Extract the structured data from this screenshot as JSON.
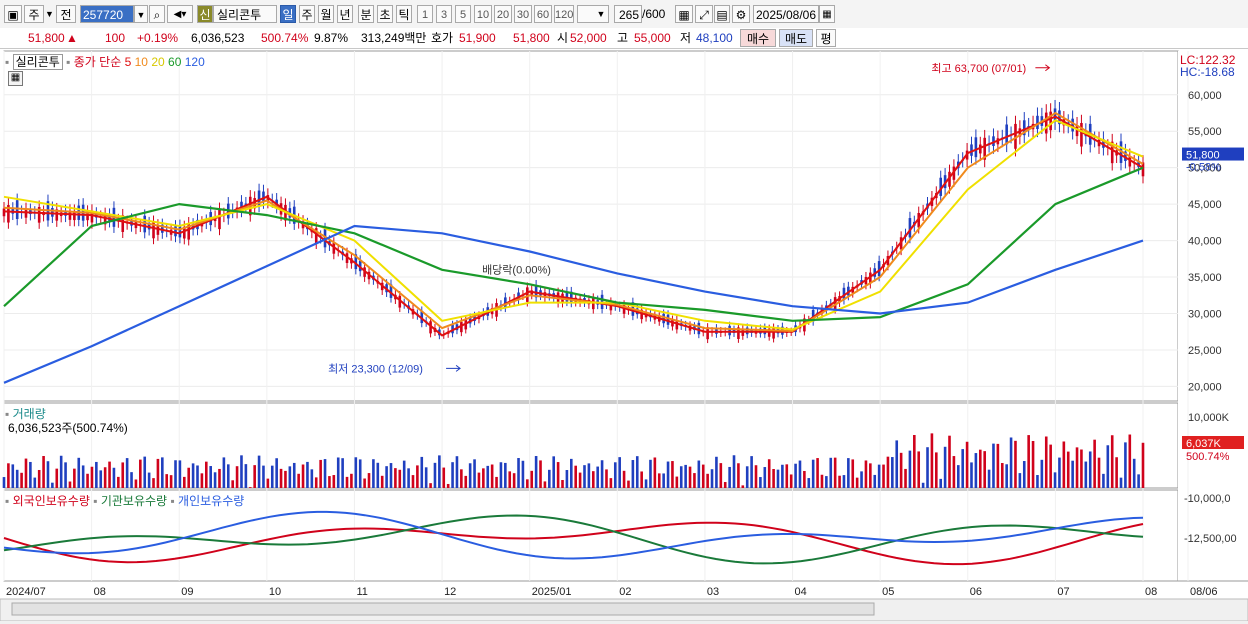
{
  "toolbar": {
    "period": "주",
    "prev": "전",
    "code": "257720",
    "badge": "신",
    "name": "실리콘투",
    "intervals": [
      "일",
      "주",
      "월",
      "년",
      "분",
      "초",
      "틱"
    ],
    "counts": [
      "1",
      "3",
      "5",
      "10",
      "20",
      "30",
      "60",
      "120"
    ],
    "count_display": "265",
    "count_total": "/600",
    "date": "2025/08/06"
  },
  "quote": {
    "price": "51,800",
    "change": "100",
    "change_pct": "+0.19%",
    "volume": "6,036,523",
    "volume_pct": "500.74%",
    "turnover_pct": "9.87%",
    "amount": "313,249백만",
    "hoga_label": "호가",
    "ask": "51,900",
    "bid": "51,800",
    "open_label": "시",
    "open": "52,000",
    "high_label": "고",
    "high": "55,000",
    "low_label": "저",
    "low": "48,100",
    "buy_button": "매수",
    "sell_button": "매도",
    "eval_button": "평"
  },
  "price_panel": {
    "name": "실리콘투",
    "ma_label": "종가 단순",
    "ma_periods": [
      "5",
      "10",
      "20",
      "60",
      "120"
    ],
    "ma_colors": [
      "#e01010",
      "#f08a1c",
      "#f0e000",
      "#1a9a2a",
      "#2a5de0"
    ],
    "lc": "LC:122.32",
    "hc": "HC:-18.68",
    "current_price": "51,800",
    "current_pct": "-0.58%",
    "y_ticks": [
      "60,000",
      "55,000",
      "50,000",
      "45,000",
      "40,000",
      "35,000",
      "30,000",
      "25,000",
      "20,000"
    ],
    "high_annotation": "최고 63,700 (07/01)",
    "low_annotation": "최저 23,300 (12/09)",
    "dividend_annotation": "배당락(0.00%)"
  },
  "volume_panel": {
    "title": "거래량",
    "value": "6,036,523주(500.74%)",
    "y_tick": "10,000K",
    "current": "6,037K",
    "current_pct": "500.74%"
  },
  "holding_panel": {
    "legends": [
      "외국인보유수량",
      "기관보유수량",
      "개인보유수량"
    ],
    "y_ticks": [
      "-10,000,0",
      "-12,500,00"
    ]
  },
  "x_axis": [
    "2024/07",
    "08",
    "09",
    "10",
    "11",
    "12",
    "2025/01",
    "02",
    "03",
    "04",
    "05",
    "06",
    "07",
    "08",
    "08/06"
  ],
  "chart_data": {
    "type": "line",
    "title": "실리콘투",
    "xlabel": "",
    "ylabel": "",
    "ylim": [
      18000,
      66000
    ],
    "period": "2024/07 - 2025/08/06",
    "x": [
      "2024/07",
      "08",
      "09",
      "10",
      "11",
      "12",
      "2025/01",
      "02",
      "03",
      "04",
      "05",
      "06",
      "07",
      "08"
    ],
    "series": [
      {
        "name": "5",
        "values": [
          44000,
          43500,
          41000,
          46000,
          37000,
          27000,
          33000,
          31000,
          27500,
          27500,
          36000,
          52000,
          57000,
          50000
        ]
      },
      {
        "name": "10",
        "values": [
          44500,
          43800,
          41500,
          45500,
          38000,
          28000,
          32500,
          31200,
          28000,
          27600,
          35000,
          50000,
          57500,
          50500
        ]
      },
      {
        "name": "20",
        "values": [
          46000,
          44000,
          42000,
          45000,
          40000,
          29000,
          31500,
          31500,
          29000,
          27800,
          33000,
          47000,
          56500,
          51500
        ]
      },
      {
        "name": "60",
        "values": [
          31000,
          42000,
          45000,
          43500,
          41000,
          36000,
          34000,
          31500,
          30500,
          29000,
          29500,
          34000,
          45000,
          50000
        ]
      },
      {
        "name": "120",
        "values": [
          20500,
          25500,
          31000,
          36500,
          42000,
          41000,
          38500,
          35500,
          33000,
          31000,
          30000,
          31500,
          36000,
          40000
        ]
      }
    ],
    "annotations": [
      {
        "text": "최고 63,700 (07/01)",
        "x": "07/01",
        "y": 63700
      },
      {
        "text": "최저 23,300 (12/09)",
        "x": "12/09",
        "y": 23300
      },
      {
        "text": "배당락(0.00%)",
        "x": "2024/12"
      }
    ],
    "last": {
      "price": 51800,
      "change": 100,
      "change_pct": 0.19
    }
  }
}
